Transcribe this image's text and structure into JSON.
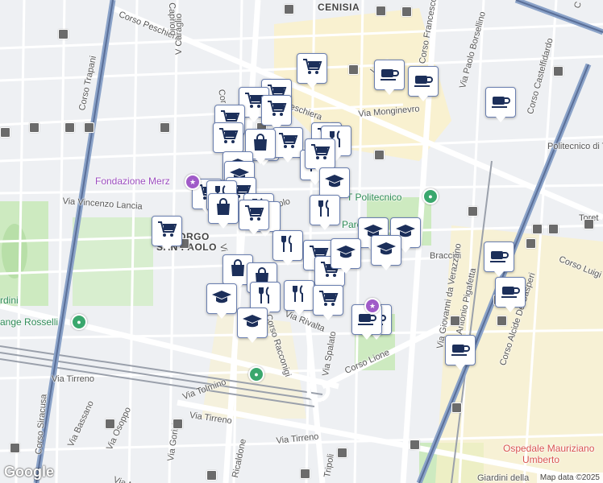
{
  "map": {
    "labels": [
      {
        "id": "cenisia",
        "text": "CENISIA",
        "cls": "district"
      },
      {
        "id": "borgo1",
        "text": "BORGO",
        "cls": "district"
      },
      {
        "id": "borgo2",
        "text": "SAN PAOLO",
        "cls": "district"
      },
      {
        "id": "corso-peschiera",
        "text": "Corso Peschiera",
        "cls": ""
      },
      {
        "id": "peschiera2",
        "text": "Peschiera",
        "cls": ""
      },
      {
        "id": "corso-trapani",
        "text": "Corso Trapani",
        "cls": ""
      },
      {
        "id": "capriolo",
        "text": "Capriolo",
        "cls": ""
      },
      {
        "id": "v-caraglio",
        "text": "V Caraglio",
        "cls": ""
      },
      {
        "id": "corso-f",
        "text": "Cor",
        "cls": ""
      },
      {
        "id": "via-monginevro",
        "text": "Via Monginevro",
        "cls": ""
      },
      {
        "id": "corso-francesco",
        "text": "Corso Francesco",
        "cls": ""
      },
      {
        "id": "via-paolo-borsellino",
        "text": "Via Paolo Borsellino",
        "cls": ""
      },
      {
        "id": "corso-castelfidardo",
        "text": "Corso Castelfidardo",
        "cls": ""
      },
      {
        "id": "fondazione-merz",
        "text": "Fondazione Merz",
        "cls": "poi-purple"
      },
      {
        "id": "via-vincenzo-lancia",
        "text": "Via Vincenzo Lancia",
        "cls": ""
      },
      {
        "id": "politecnico",
        "text": "Politecnico di Torino",
        "cls": ""
      },
      {
        "id": "t-politecnico",
        "text": "T Politecnico",
        "cls": "poi-green"
      },
      {
        "id": "toret",
        "text": "Toret",
        "cls": ""
      },
      {
        "id": "braccini",
        "text": "Braccini",
        "cls": ""
      },
      {
        "id": "corso-luigi",
        "text": "Corso Luigi",
        "cls": ""
      },
      {
        "id": "via-giovanni",
        "text": "Via Giovanni da Verazzano",
        "cls": ""
      },
      {
        "id": "via-pigafetta",
        "text": "Antonio Pigafetta",
        "cls": ""
      },
      {
        "id": "corso-alcide",
        "text": "Corso Alcide De Gasperi",
        "cls": ""
      },
      {
        "id": "ange-rosselli",
        "text": "ange Rosselli",
        "cls": "poi-green"
      },
      {
        "id": "rdini",
        "text": "rdini",
        "cls": "poi-green"
      },
      {
        "id": "via-rivalta",
        "text": "Via Rivalta",
        "cls": ""
      },
      {
        "id": "corso-racconigi",
        "text": "Corso Racconigi",
        "cls": ""
      },
      {
        "id": "via-spalato",
        "text": "Via Spalato",
        "cls": ""
      },
      {
        "id": "corso-lione",
        "text": "Corso Lione",
        "cls": ""
      },
      {
        "id": "via-tolmino",
        "text": "Via Tolmino",
        "cls": ""
      },
      {
        "id": "via-tirreno-1",
        "text": "Via Tirreno",
        "cls": ""
      },
      {
        "id": "via-tirreno-2",
        "text": "Via Tirreno",
        "cls": ""
      },
      {
        "id": "via-tirreno-3",
        "text": "Via Tirreno",
        "cls": ""
      },
      {
        "id": "corso-siracusa",
        "text": "Corso Siracusa",
        "cls": ""
      },
      {
        "id": "via-bassano",
        "text": "Via Bassano",
        "cls": ""
      },
      {
        "id": "via-osoppo",
        "text": "Via Osoppo",
        "cls": ""
      },
      {
        "id": "via-gorizia",
        "text": "Via Gorizia",
        "cls": ""
      },
      {
        "id": "via-ricaldone",
        "text": "Ricaldone",
        "cls": ""
      },
      {
        "id": "via-mon",
        "text": "Via Mon",
        "cls": ""
      },
      {
        "id": "tripoli",
        "text": "Tripoli",
        "cls": ""
      },
      {
        "id": "ospedale",
        "text": "Ospedale Mauriziano",
        "cls": "poi-red"
      },
      {
        "id": "umberto",
        "text": "Umberto",
        "cls": "poi-red"
      },
      {
        "id": "giardini",
        "text": "Giardini della",
        "cls": ""
      },
      {
        "id": "parco",
        "text": "Parc",
        "cls": "poi-green"
      },
      {
        "id": "paolo-st",
        "text": "olo",
        "cls": ""
      },
      {
        "id": "via-c",
        "text": "Via C",
        "cls": ""
      },
      {
        "id": "via-vi",
        "text": "Vi",
        "cls": ""
      },
      {
        "id": "corso-s",
        "text": "C s",
        "cls": ""
      }
    ],
    "markers": [
      {
        "icon": "cart"
      },
      {
        "icon": "coffee"
      },
      {
        "icon": "coffee"
      },
      {
        "icon": "coffee"
      },
      {
        "icon": "cart"
      },
      {
        "icon": "cart"
      },
      {
        "icon": "cart"
      },
      {
        "icon": "cart"
      },
      {
        "icon": "cart"
      },
      {
        "icon": "cart"
      },
      {
        "icon": "cart"
      },
      {
        "icon": "cart"
      },
      {
        "icon": "fork"
      },
      {
        "icon": "bag"
      },
      {
        "icon": "fork"
      },
      {
        "icon": "cart"
      },
      {
        "icon": "cap"
      },
      {
        "icon": "cap"
      },
      {
        "icon": "cart"
      },
      {
        "icon": "cart"
      },
      {
        "icon": "cap"
      },
      {
        "icon": "fork"
      },
      {
        "icon": "fork"
      },
      {
        "icon": "fork"
      },
      {
        "icon": "cart"
      },
      {
        "icon": "fork"
      },
      {
        "icon": "cart"
      },
      {
        "icon": "bag"
      },
      {
        "icon": "cap"
      },
      {
        "icon": "cap"
      },
      {
        "icon": "fork"
      },
      {
        "icon": "cap"
      },
      {
        "icon": "cart"
      },
      {
        "icon": "cart"
      },
      {
        "icon": "bag"
      },
      {
        "icon": "bag"
      },
      {
        "icon": "cap"
      },
      {
        "icon": "fork"
      },
      {
        "icon": "fork"
      },
      {
        "icon": "cart"
      },
      {
        "icon": "cap"
      },
      {
        "icon": "cap"
      },
      {
        "icon": "coffee"
      },
      {
        "icon": "coffee"
      },
      {
        "icon": "coffee"
      },
      {
        "icon": "coffee"
      },
      {
        "icon": "coffee"
      }
    ],
    "attribution": "Map data ©2025",
    "logo": "Google"
  }
}
